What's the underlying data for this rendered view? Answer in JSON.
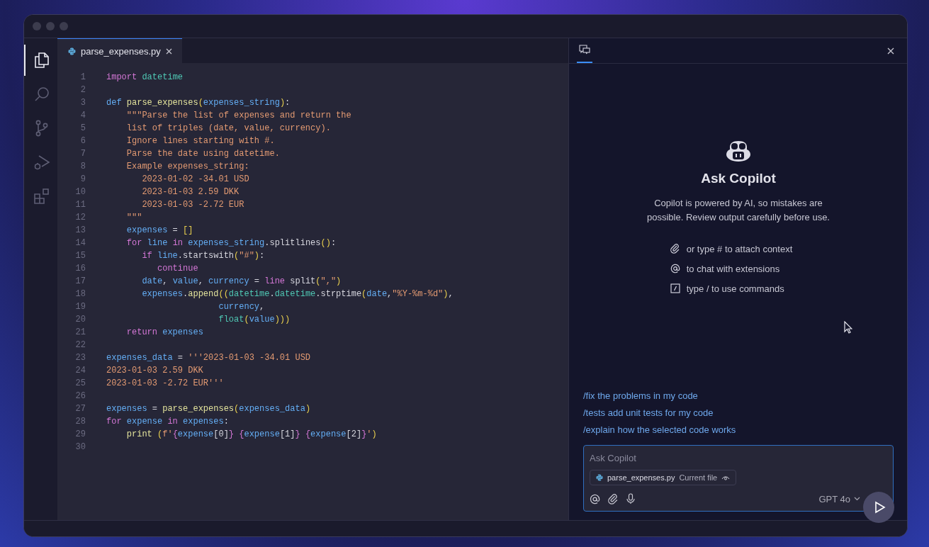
{
  "activity_bar": [
    {
      "kind": "files",
      "selected": true
    },
    {
      "kind": "search",
      "selected": false
    },
    {
      "kind": "source-control",
      "selected": false
    },
    {
      "kind": "run-debug",
      "selected": false
    },
    {
      "kind": "extensions",
      "selected": false
    }
  ],
  "editor": {
    "tabs": [
      {
        "label": "parse_expenses.py",
        "selected": true
      }
    ],
    "lines": [
      {
        "number": "1",
        "tokens": [
          {
            "text": "import ",
            "kind": "kw"
          },
          {
            "text": "datetime",
            "kind": "mod"
          }
        ]
      },
      {
        "number": "2"
      },
      {
        "number": "3",
        "tokens": [
          {
            "text": "def ",
            "kind": "var"
          },
          {
            "text": "parse_expenses",
            "kind": "fn"
          },
          {
            "text": "(",
            "kind": "brk"
          },
          {
            "text": "expenses_string",
            "kind": "var"
          },
          {
            "text": ")",
            "kind": "brk"
          },
          {
            "text": ":",
            "kind": "plain"
          }
        ]
      },
      {
        "number": "4",
        "tokens": [
          {
            "text": "    \"\"\"Parse the list of expenses and return the",
            "kind": "str"
          }
        ]
      },
      {
        "number": "5",
        "tokens": [
          {
            "text": "    list of triples (date, value, currency).",
            "kind": "str"
          }
        ]
      },
      {
        "number": "6",
        "tokens": [
          {
            "text": "    Ignore lines starting with #.",
            "kind": "str"
          }
        ]
      },
      {
        "number": "7",
        "tokens": [
          {
            "text": "    Parse the date using datetime.",
            "kind": "str"
          }
        ]
      },
      {
        "number": "8",
        "tokens": [
          {
            "text": "    Example expenses_string:",
            "kind": "str"
          }
        ]
      },
      {
        "number": "9",
        "tokens": [
          {
            "text": "       2023-01-02 -34.01 USD",
            "kind": "str"
          }
        ]
      },
      {
        "number": "10",
        "tokens": [
          {
            "text": "       2023-01-03 2.59 DKK",
            "kind": "str"
          }
        ]
      },
      {
        "number": "11",
        "tokens": [
          {
            "text": "       2023-01-03 -2.72 EUR",
            "kind": "str"
          }
        ]
      },
      {
        "number": "12",
        "tokens": [
          {
            "text": "    \"\"\"",
            "kind": "str"
          }
        ]
      },
      {
        "number": "13",
        "tokens": [
          {
            "text": "    expenses",
            "kind": "var"
          },
          {
            "text": " = ",
            "kind": "plain"
          },
          {
            "text": "[]",
            "kind": "brk"
          }
        ]
      },
      {
        "number": "14",
        "tokens": [
          {
            "text": "    for ",
            "kind": "kw"
          },
          {
            "text": "line ",
            "kind": "var"
          },
          {
            "text": "in ",
            "kind": "kw"
          },
          {
            "text": "expenses_string",
            "kind": "var"
          },
          {
            "text": ".splitlines",
            "kind": "plain"
          },
          {
            "text": "()",
            "kind": "brk"
          },
          {
            "text": ":",
            "kind": "plain"
          }
        ]
      },
      {
        "number": "15",
        "tokens": [
          {
            "text": "       if ",
            "kind": "kw"
          },
          {
            "text": "line",
            "kind": "var"
          },
          {
            "text": ".startswith",
            "kind": "plain"
          },
          {
            "text": "(",
            "kind": "brk"
          },
          {
            "text": "\"#\"",
            "kind": "str"
          },
          {
            "text": ")",
            "kind": "brk"
          },
          {
            "text": ":",
            "kind": "plain"
          }
        ]
      },
      {
        "number": "16",
        "tokens": [
          {
            "text": "          continue",
            "kind": "kw"
          }
        ]
      },
      {
        "number": "17",
        "tokens": [
          {
            "text": "       date",
            "kind": "var"
          },
          {
            "text": ", ",
            "kind": "plain"
          },
          {
            "text": "value",
            "kind": "var"
          },
          {
            "text": ", ",
            "kind": "plain"
          },
          {
            "text": "currency",
            "kind": "var"
          },
          {
            "text": " = ",
            "kind": "plain"
          },
          {
            "text": "line",
            "kind": "kw"
          },
          {
            "text": " split",
            "kind": "plain"
          },
          {
            "text": "(",
            "kind": "brk"
          },
          {
            "text": "\",\"",
            "kind": "str"
          },
          {
            "text": ")",
            "kind": "brk"
          }
        ]
      },
      {
        "number": "18",
        "tokens": [
          {
            "text": "       expenses",
            "kind": "var"
          },
          {
            "text": ".",
            "kind": "plain"
          },
          {
            "text": "append",
            "kind": "fn"
          },
          {
            "text": "((",
            "kind": "brk"
          },
          {
            "text": "datetime",
            "kind": "mod"
          },
          {
            "text": ".",
            "kind": "plain"
          },
          {
            "text": "datetime",
            "kind": "mod"
          },
          {
            "text": ".strptime",
            "kind": "plain"
          },
          {
            "text": "(",
            "kind": "brk"
          },
          {
            "text": "date",
            "kind": "var"
          },
          {
            "text": ",",
            "kind": "plain"
          },
          {
            "text": "\"%Y-%m-%d\"",
            "kind": "str"
          },
          {
            "text": ")",
            "kind": "brk"
          },
          {
            "text": ",",
            "kind": "plain"
          }
        ]
      },
      {
        "number": "19",
        "tokens": [
          {
            "text": "                      currency",
            "kind": "var"
          },
          {
            "text": ",",
            "kind": "plain"
          }
        ]
      },
      {
        "number": "20",
        "tokens": [
          {
            "text": "                      float",
            "kind": "mod"
          },
          {
            "text": "(",
            "kind": "brk"
          },
          {
            "text": "value",
            "kind": "var"
          },
          {
            "text": ")))",
            "kind": "brk"
          }
        ]
      },
      {
        "number": "21",
        "tokens": [
          {
            "text": "    return ",
            "kind": "kw"
          },
          {
            "text": "expenses",
            "kind": "var"
          }
        ]
      },
      {
        "number": "22"
      },
      {
        "number": "23",
        "tokens": [
          {
            "text": "expenses_data",
            "kind": "var"
          },
          {
            "text": " = ",
            "kind": "plain"
          },
          {
            "text": "'''2023-01-03 -34.01 USD",
            "kind": "str"
          }
        ]
      },
      {
        "number": "24",
        "tokens": [
          {
            "text": "2023-01-03 2.59 DKK",
            "kind": "str"
          }
        ]
      },
      {
        "number": "25",
        "tokens": [
          {
            "text": "2023-01-03 -2.72 EUR'''",
            "kind": "str"
          }
        ]
      },
      {
        "number": "26"
      },
      {
        "number": "27",
        "tokens": [
          {
            "text": "expenses",
            "kind": "var"
          },
          {
            "text": " = ",
            "kind": "plain"
          },
          {
            "text": "parse_expenses",
            "kind": "fn"
          },
          {
            "text": "(",
            "kind": "brk"
          },
          {
            "text": "expenses_data",
            "kind": "var"
          },
          {
            "text": ")",
            "kind": "brk"
          }
        ]
      },
      {
        "number": "28",
        "tokens": [
          {
            "text": "for ",
            "kind": "kw"
          },
          {
            "text": "expense ",
            "kind": "var"
          },
          {
            "text": "in ",
            "kind": "kw"
          },
          {
            "text": "expenses",
            "kind": "var"
          },
          {
            "text": ":",
            "kind": "plain"
          }
        ]
      },
      {
        "number": "29",
        "tokens": [
          {
            "text": "    print ",
            "kind": "fn"
          },
          {
            "text": "(",
            "kind": "brk"
          },
          {
            "text": "f'",
            "kind": "str"
          },
          {
            "text": "{",
            "kind": "kw"
          },
          {
            "text": "expense",
            "kind": "var"
          },
          {
            "text": "[0]",
            "kind": "plain"
          },
          {
            "text": "} ",
            "kind": "kw"
          },
          {
            "text": "{",
            "kind": "kw"
          },
          {
            "text": "expense",
            "kind": "var"
          },
          {
            "text": "[1]",
            "kind": "plain"
          },
          {
            "text": "} ",
            "kind": "kw"
          },
          {
            "text": "{",
            "kind": "kw"
          },
          {
            "text": "expense",
            "kind": "var"
          },
          {
            "text": "[2]",
            "kind": "plain"
          },
          {
            "text": "}",
            "kind": "kw"
          },
          {
            "text": "'",
            "kind": "str"
          },
          {
            "text": ")",
            "kind": "brk"
          }
        ]
      },
      {
        "number": "30"
      }
    ]
  },
  "chat": {
    "tabs": [
      {
        "kind": "chat",
        "selected": true
      }
    ],
    "title": "Ask Copilot",
    "description": "Copilot is powered by AI, so mistakes are possible. Review output carefully before use.",
    "hints": [
      {
        "kind": "attach",
        "text": "or type # to attach context"
      },
      {
        "kind": "mention",
        "text": "to chat with extensions"
      },
      {
        "kind": "command",
        "text": "type / to use commands"
      }
    ],
    "suggestions": [
      "/fix the problems in my code",
      "/tests add unit tests for my code",
      "/explain how the selected code works"
    ],
    "input": {
      "placeholder": "Ask Copilot",
      "context_file": "parse_expenses.py",
      "context_label": "Current file",
      "model": "GPT 4o"
    }
  }
}
